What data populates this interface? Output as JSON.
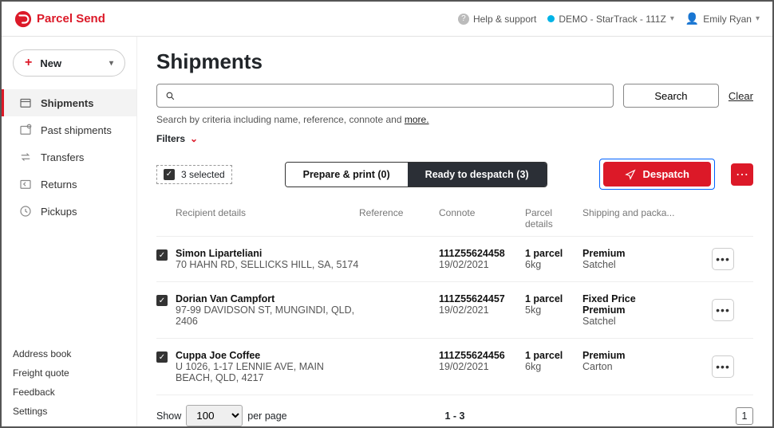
{
  "brand": "Parcel Send",
  "header": {
    "help": "Help & support",
    "account": "DEMO - StarTrack - 111Z",
    "user": "Emily Ryan"
  },
  "sidebar": {
    "new": "New",
    "items": [
      {
        "label": "Shipments"
      },
      {
        "label": "Past shipments"
      },
      {
        "label": "Transfers"
      },
      {
        "label": "Returns"
      },
      {
        "label": "Pickups"
      }
    ],
    "bottom": [
      {
        "label": "Address book"
      },
      {
        "label": "Freight quote"
      },
      {
        "label": "Feedback"
      },
      {
        "label": "Settings"
      }
    ]
  },
  "page": {
    "title": "Shipments",
    "searchBtn": "Search",
    "clear": "Clear",
    "hintPrefix": "Search by criteria including name, reference, connote and ",
    "hintMore": "more.",
    "filters": "Filters"
  },
  "actions": {
    "selected": "3 selected",
    "prepare": "Prepare & print (0)",
    "ready": "Ready to despatch (3)",
    "despatch": "Despatch"
  },
  "columns": {
    "recipient": "Recipient details",
    "reference": "Reference",
    "connote": "Connote",
    "parcel": "Parcel details",
    "shipping": "Shipping and packa..."
  },
  "rows": [
    {
      "name": "Simon Liparteliani",
      "addr": "70 HAHN RD, SELLICKS HILL, SA, 5174",
      "connote": "111Z55624458",
      "date": "19/02/2021",
      "parcels": "1 parcel",
      "weight": "6kg",
      "ship1": "Premium",
      "ship2": "Satchel",
      "ship3": ""
    },
    {
      "name": "Dorian Van Campfort",
      "addr": "97-99 DAVIDSON ST, MUNGINDI, QLD, 2406",
      "connote": "111Z55624457",
      "date": "19/02/2021",
      "parcels": "1 parcel",
      "weight": "5kg",
      "ship1": "Fixed Price",
      "ship2": "Premium",
      "ship3": "Satchel"
    },
    {
      "name": "Cuppa Joe Coffee",
      "addr": "U 1026, 1-17 LENNIE AVE, MAIN BEACH, QLD, 4217",
      "connote": "111Z55624456",
      "date": "19/02/2021",
      "parcels": "1 parcel",
      "weight": "6kg",
      "ship1": "Premium",
      "ship2": "Carton",
      "ship3": ""
    }
  ],
  "pager": {
    "show": "Show",
    "perpage": "per page",
    "size": "100",
    "range": "1 - 3",
    "page": "1"
  }
}
